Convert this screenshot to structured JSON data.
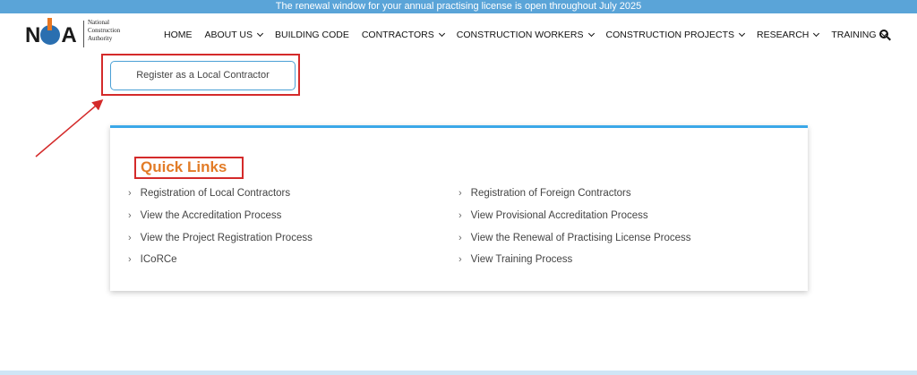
{
  "banner": {
    "text": "The renewal window for your annual practising license is open throughout July 2025"
  },
  "logo": {
    "mark": "NCA",
    "line1": "National",
    "line2": "Construction",
    "line3": "Authority"
  },
  "nav": {
    "items": [
      {
        "label": "HOME",
        "has_dropdown": false
      },
      {
        "label": "ABOUT US",
        "has_dropdown": true
      },
      {
        "label": "BUILDING CODE",
        "has_dropdown": false
      },
      {
        "label": "CONTRACTORS",
        "has_dropdown": true
      },
      {
        "label": "CONSTRUCTION WORKERS",
        "has_dropdown": true
      },
      {
        "label": "CONSTRUCTION PROJECTS",
        "has_dropdown": true
      },
      {
        "label": "RESEARCH",
        "has_dropdown": true
      },
      {
        "label": "TRAINING",
        "has_dropdown": true
      }
    ],
    "search_icon": "search-icon"
  },
  "register_button": {
    "label": "Register as a Local Contractor"
  },
  "quick_links": {
    "title": "Quick Links",
    "left": [
      "Registration of Local Contractors",
      "View the Accreditation Process",
      "View the Project Registration Process",
      "ICoRCe"
    ],
    "right": [
      "Registration of Foreign Contractors",
      "View Provisional Accreditation Process",
      "View the Renewal of Practising License Process",
      "View Training Process"
    ],
    "caret": "›"
  },
  "colors": {
    "banner_bg": "#5aa4d8",
    "accent_orange": "#e27c27",
    "highlight_red": "#d42a2a",
    "card_top_border": "#3ba8e8"
  }
}
